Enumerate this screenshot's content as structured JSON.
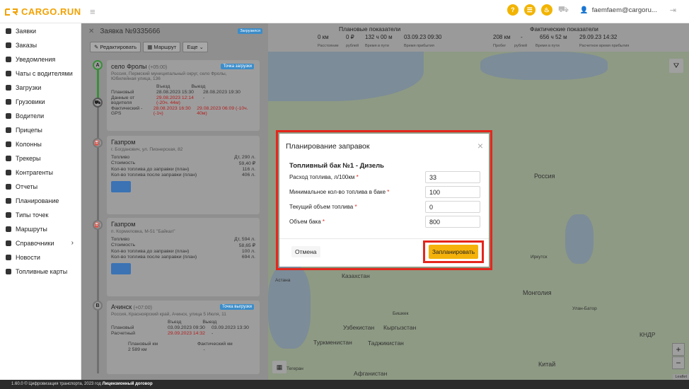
{
  "brand": {
    "logo": "CARGO.RUN",
    "accent": "#f2a100"
  },
  "header": {
    "user": "faemfaem@cargoru...",
    "icons": [
      "help-icon",
      "chat-icon",
      "fire-icon",
      "truck-icon",
      "user-icon",
      "logout-icon"
    ]
  },
  "sidebar": {
    "items": [
      {
        "label": "Заявки",
        "icon": "clipboard-icon"
      },
      {
        "label": "Заказы",
        "icon": "cart-icon"
      },
      {
        "label": "Уведомления",
        "icon": "bell-icon"
      },
      {
        "label": "Чаты с водителями",
        "icon": "chat-icon"
      },
      {
        "label": "Загрузки",
        "icon": "download-icon"
      },
      {
        "label": "Грузовики",
        "icon": "truck-icon"
      },
      {
        "label": "Водители",
        "icon": "drivers-icon"
      },
      {
        "label": "Прицепы",
        "icon": "trailer-icon"
      },
      {
        "label": "Колонны",
        "icon": "column-icon"
      },
      {
        "label": "Трекеры",
        "icon": "pin-icon"
      },
      {
        "label": "Контрагенты",
        "icon": "handshake-icon"
      },
      {
        "label": "Отчеты",
        "icon": "report-icon"
      },
      {
        "label": "Планирование",
        "icon": "planning-icon"
      },
      {
        "label": "Типы точек",
        "icon": "marker-icon"
      },
      {
        "label": "Маршруты",
        "icon": "route-icon"
      },
      {
        "label": "Справочники",
        "icon": "book-icon",
        "chevron": "›"
      },
      {
        "label": "Новости",
        "icon": "news-icon"
      },
      {
        "label": "Топливные карты",
        "icon": "fuel-card-icon"
      }
    ]
  },
  "order": {
    "title": "Заявка №9335666",
    "status": "Загрузился",
    "edit": "Редактировать",
    "route": "Маршрут",
    "more": "Еще"
  },
  "stops": [
    {
      "letter": "A",
      "name": "село Фролы",
      "tz": "(+05:00)",
      "tag": "Точка загрузки",
      "addr": "Россия, Пермский муниципальный округ, село Фролы, Юбилейная улица, 136",
      "col1": "Въезд",
      "col2": "Выезд",
      "rows": [
        {
          "label": "Плановый",
          "v1": "28.08.2023 15:30",
          "v2": "28.08.2023 19:30",
          "red": false
        },
        {
          "label": "Данные от водителя",
          "v1": "29.08.2023 12:14 (-20ч. 44м)",
          "v2": "-",
          "red": true
        },
        {
          "label": "Фактический - GPS",
          "v1": "28.08.2023 16:30 (-1ч)",
          "v2": "29.08.2023 06:09 (-10ч. 40м)",
          "red": true
        }
      ]
    },
    {
      "name": "Газпром",
      "addr": "г. Богданович, ул. Пионерская, 82",
      "rows": [
        {
          "label": "Топливо",
          "value": "Дт, 290 л."
        },
        {
          "label": "Стоимость",
          "value": "59,40 ₽"
        },
        {
          "label": "Кол-во топлива до заправки (план)",
          "value": "116 л."
        },
        {
          "label": "Кол-во топлива после заправки (план)",
          "value": "406 л."
        }
      ]
    },
    {
      "name": "Газпром",
      "addr": "п. Кормиловка, М-51 \"Байкал\"",
      "rows": [
        {
          "label": "Топливо",
          "value": "Дт, 594 л."
        },
        {
          "label": "Стоимость",
          "value": "58,65 ₽"
        },
        {
          "label": "Кол-во топлива до заправки (план)",
          "value": "100 л."
        },
        {
          "label": "Кол-во топлива после заправки (план)",
          "value": "694 л."
        }
      ]
    },
    {
      "letter": "B",
      "name": "Ачинск",
      "tz": "(+07:00)",
      "tag": "Точка выгрузки",
      "addr": "Россия, Красноярский край, Ачинск, улица 5 Июля, 11",
      "col1": "Въезд",
      "col2": "Выезд",
      "rows": [
        {
          "label": "Плановый",
          "v1": "03.09.2023 09:30",
          "v2": "03.09.2023 13:30"
        },
        {
          "label": "Расчетный",
          "v1": "29.09.2023 14:32",
          "v2": "-"
        }
      ],
      "plan_km_label": "Плановый км",
      "plan_km": "2 589 км",
      "fact_km_label": "Фактический км",
      "fact_km": "-"
    }
  ],
  "stats": {
    "plan_title": "Плановые показатели",
    "fact_title": "Фактические показатели",
    "plan": [
      {
        "value": "0 км",
        "label": "Расстояние"
      },
      {
        "value": "0 ₽",
        "label": "рублей"
      },
      {
        "value": "132 ч 00 м",
        "label": "Время в пути"
      },
      {
        "value": "03.09.23 09:30",
        "label": "Время прибытия"
      }
    ],
    "fact": [
      {
        "value": "208 км",
        "label": "Пробег"
      },
      {
        "value": "-",
        "label": "рублей"
      },
      {
        "value": "656 ч 52 м",
        "label": "Время в пути"
      },
      {
        "value": "29.09.23 14:32",
        "label": "Расчетное время прибытия"
      }
    ]
  },
  "map_labels": [
    "Россия",
    "Казахстан",
    "Монголия",
    "Узбекистан",
    "Кыргызстан",
    "Туркменистан",
    "Таджикистан",
    "Бишкек",
    "Афганистан",
    "Китай",
    "Тегеран",
    "Иркутск",
    "КНДР",
    "Улан-Батор",
    "Астана"
  ],
  "map_controls": {
    "zoom_in": "+",
    "zoom_out": "−",
    "attribution": "Leaflet"
  },
  "modal": {
    "title": "Планирование заправок",
    "section": "Топливный бак №1 - Дизель",
    "fields": [
      {
        "label": "Расход топлива, л/100км",
        "required": "*",
        "value": "33"
      },
      {
        "label": "Минимальное кол-во топлива в баке",
        "required": "*",
        "value": "100"
      },
      {
        "label": "Текущий объем топлива",
        "required": "*",
        "value": "0"
      },
      {
        "label": "Объем бака",
        "required": "*",
        "value": "800"
      }
    ],
    "cancel": "Отмена",
    "submit": "Запланировать",
    "close": "×"
  },
  "footer": {
    "text": "1.60.0 © Цифровизация транспорта, 2023 год",
    "link": "Лицензионный договор"
  }
}
